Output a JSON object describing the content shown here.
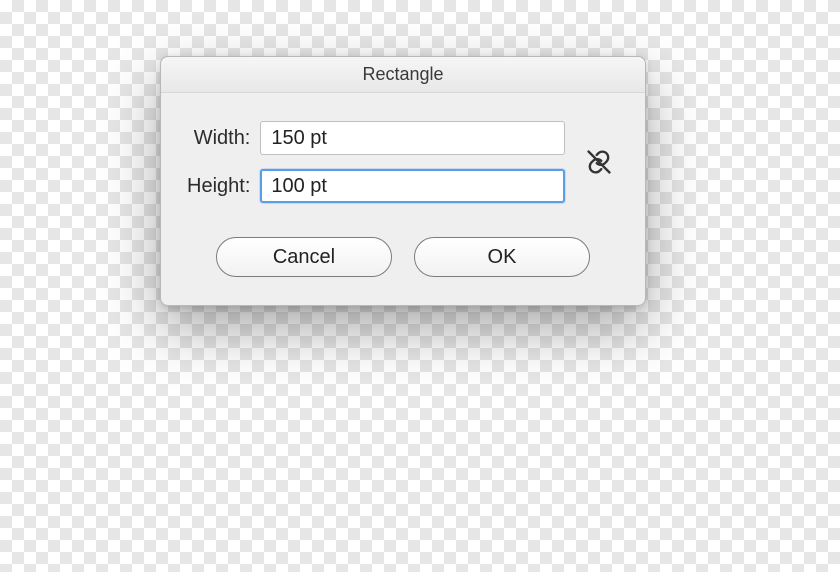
{
  "dialog": {
    "title": "Rectangle",
    "width_label": "Width:",
    "width_value": "150 pt",
    "height_label": "Height:",
    "height_value": "100 pt",
    "cancel_label": "Cancel",
    "ok_label": "OK",
    "link_constrained": false
  }
}
